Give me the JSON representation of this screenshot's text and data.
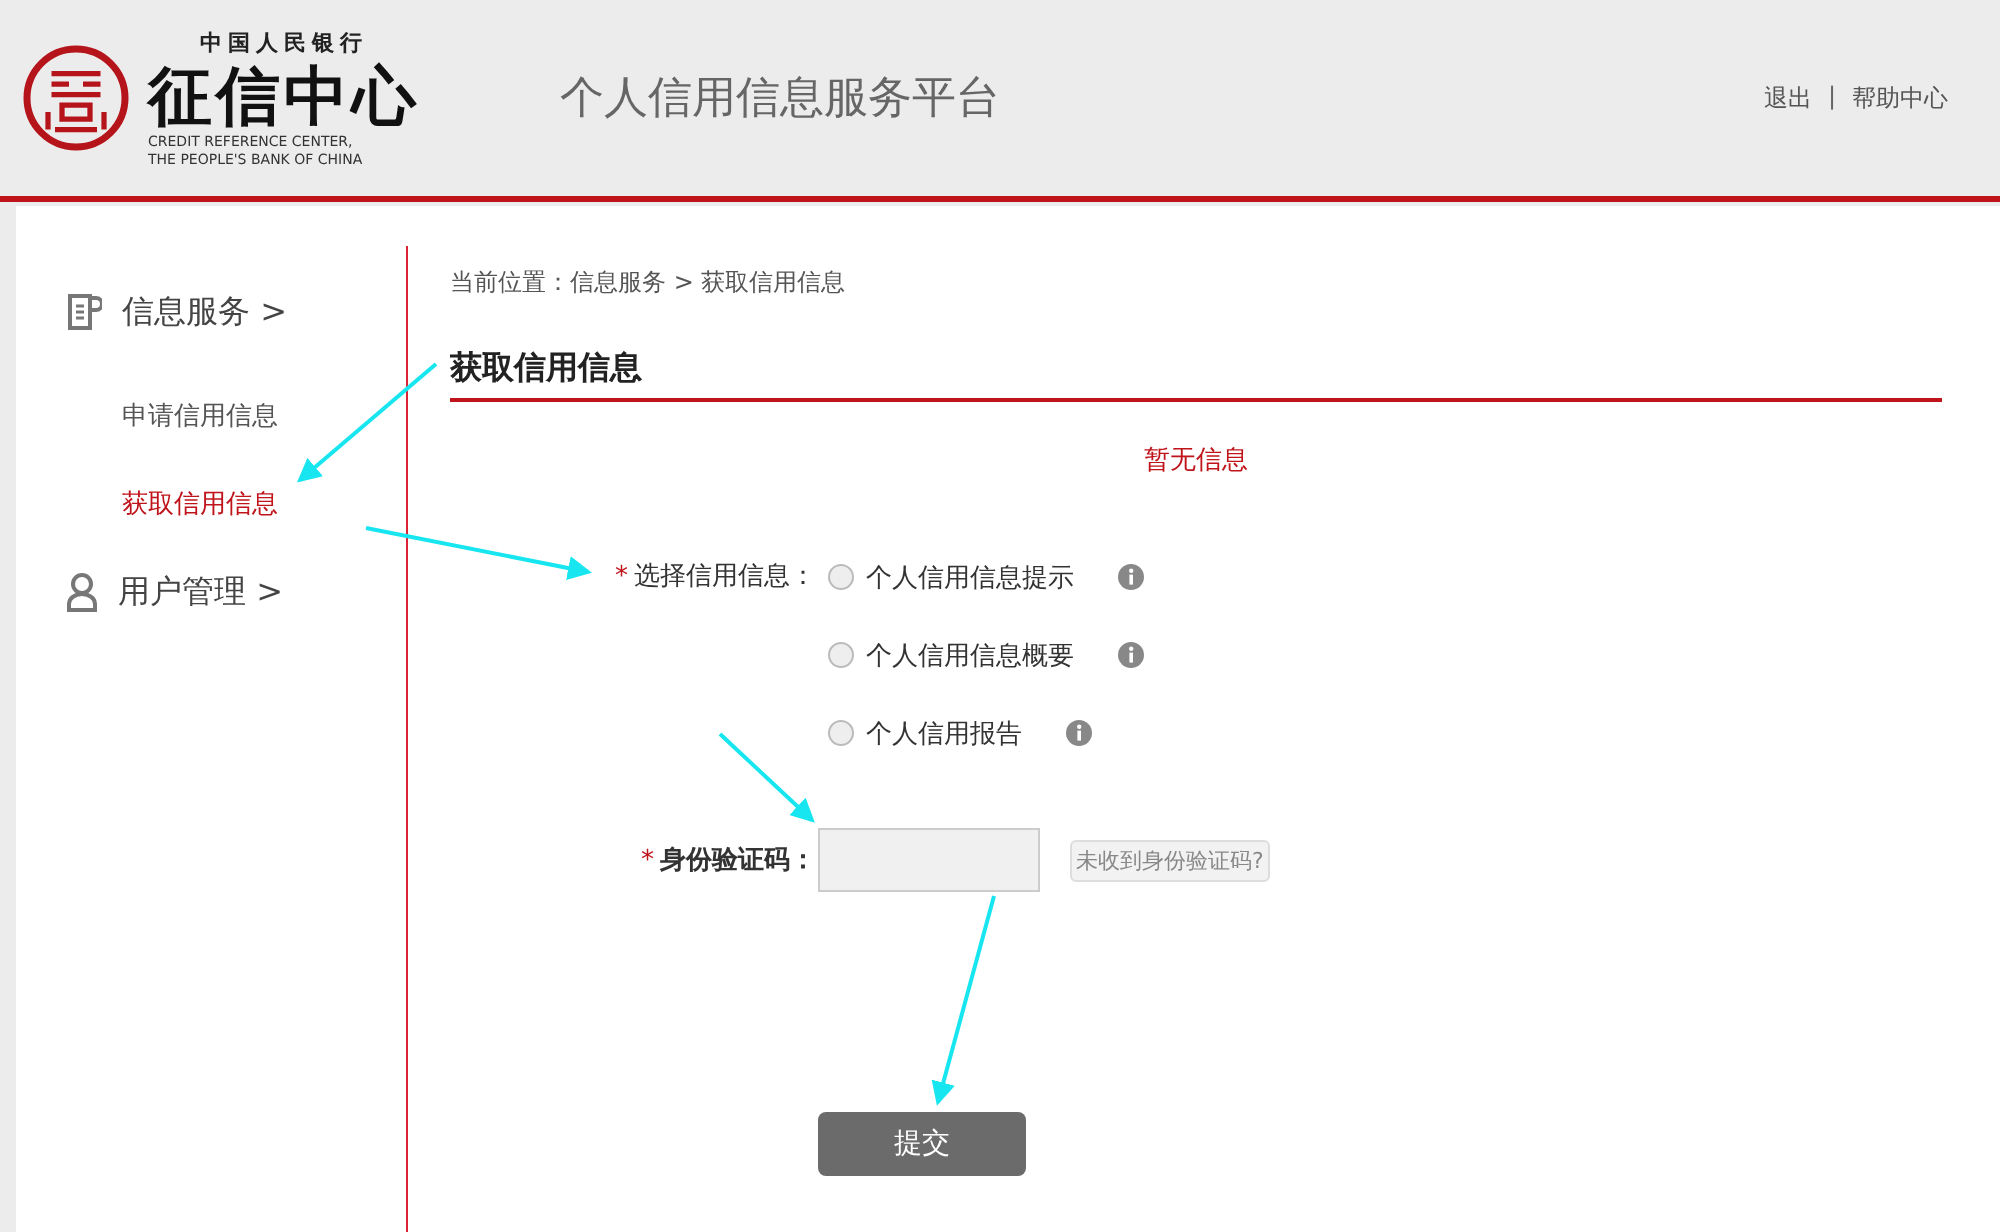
{
  "header": {
    "logo": {
      "top_text": "中国人民银行",
      "name": "征信中心",
      "english_line_1": "CREDIT REFERENCE CENTER,",
      "english_line_2": "THE PEOPLE'S BANK OF CHINA"
    },
    "platform_title": "个人信用信息服务平台",
    "links": [
      "退出",
      "帮助中心"
    ],
    "separator": "|"
  },
  "sidebar": {
    "sections": [
      {
        "kind": "document",
        "label": "信息服务 >",
        "children": [
          {
            "label": "申请信用信息",
            "selected": false
          },
          {
            "label": "获取信用信息",
            "selected": true
          }
        ]
      },
      {
        "kind": "user",
        "label": "用户管理 >"
      }
    ]
  },
  "breadcrumb": "当前位置：信息服务 > 获取信用信息",
  "page_title": "获取信用信息",
  "notice": "暂无信息",
  "form": {
    "required_mark": "*",
    "select_label": "选择信用信息：",
    "options": [
      {
        "label": "个人信用信息提示",
        "selected": false
      },
      {
        "label": "个人信用信息概要",
        "selected": false
      },
      {
        "label": "个人信用报告",
        "selected": false
      }
    ],
    "code_label": "身份验证码：",
    "resend_button": "未收到身份验证码?",
    "submit_button": "提交"
  }
}
